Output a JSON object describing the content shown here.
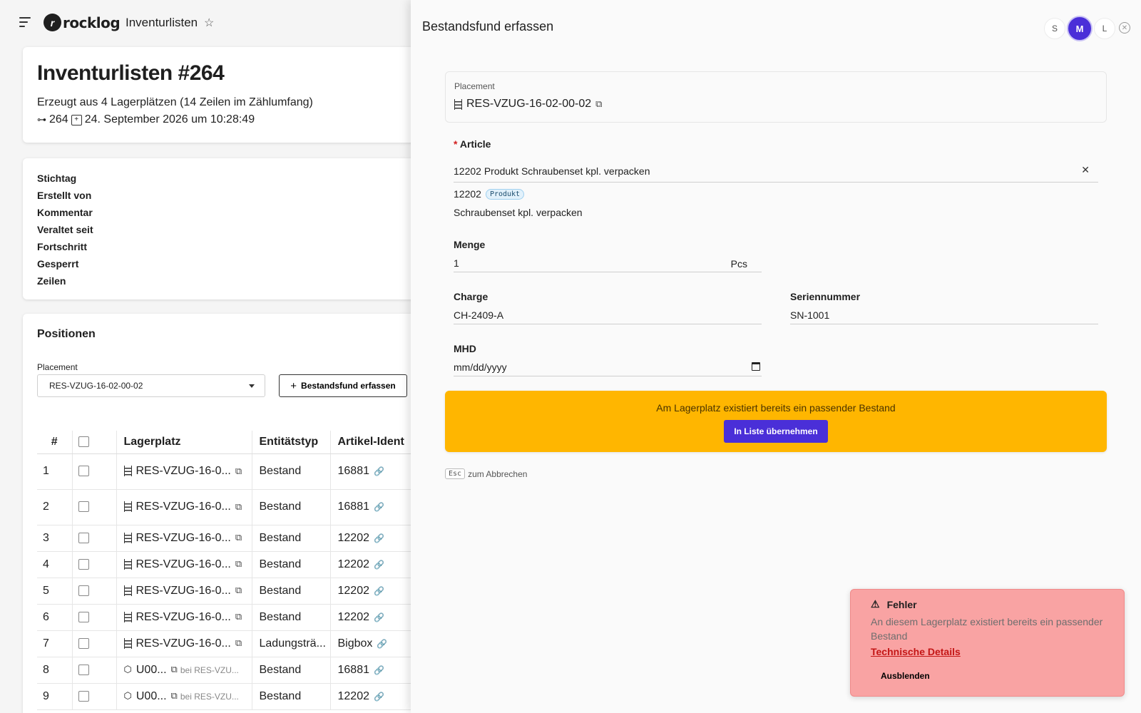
{
  "header": {
    "logo_text": "rocklog",
    "app_title": "Inventurlisten"
  },
  "detail": {
    "title": "Inventurlisten #264",
    "subtitle": "Erzeugt aus 4 Lagerplätzen (14 Zeilen im Zählumfang)",
    "id": "264",
    "created": "24. September 2026 um 10:28:49"
  },
  "properties": [
    "Stichtag",
    "Erstellt von",
    "Kommentar",
    "Veraltet seit",
    "Fortschritt",
    "Gesperrt",
    "Zeilen"
  ],
  "positions": {
    "title": "Positionen",
    "placement_label": "Placement",
    "placement_value": "RES-VZUG-16-02-00-02",
    "add_button": "Bestandsfund erfassen",
    "columns": [
      "#",
      "",
      "Lagerplatz",
      "Entitätstyp",
      "Artikel-Ident"
    ],
    "rows": [
      {
        "num": "1",
        "icon": "shelf",
        "place": "RES-VZUG-16-0...",
        "bei": "",
        "type": "Bestand",
        "article": "16881"
      },
      {
        "num": "2",
        "icon": "shelf",
        "place": "RES-VZUG-16-0...",
        "bei": "",
        "type": "Bestand",
        "article": "16881"
      },
      {
        "num": "3",
        "icon": "shelf",
        "place": "RES-VZUG-16-0...",
        "bei": "",
        "type": "Bestand",
        "article": "12202"
      },
      {
        "num": "4",
        "icon": "shelf",
        "place": "RES-VZUG-16-0...",
        "bei": "",
        "type": "Bestand",
        "article": "12202"
      },
      {
        "num": "5",
        "icon": "shelf",
        "place": "RES-VZUG-16-0...",
        "bei": "",
        "type": "Bestand",
        "article": "12202"
      },
      {
        "num": "6",
        "icon": "shelf",
        "place": "RES-VZUG-16-0...",
        "bei": "",
        "type": "Bestand",
        "article": "12202"
      },
      {
        "num": "7",
        "icon": "shelf",
        "place": "RES-VZUG-16-0...",
        "bei": "",
        "type": "Ladungsträ...",
        "article": "Bigbox"
      },
      {
        "num": "8",
        "icon": "box",
        "place": "U00...",
        "bei": "bei RES-VZU...",
        "type": "Bestand",
        "article": "16881"
      },
      {
        "num": "9",
        "icon": "box",
        "place": "U00...",
        "bei": "bei RES-VZU...",
        "type": "Bestand",
        "article": "12202"
      }
    ]
  },
  "drawer": {
    "title": "Bestandsfund erfassen",
    "sizes": [
      "S",
      "M",
      "L"
    ],
    "active_size": "M",
    "placement_label": "Placement",
    "placement_value": "RES-VZUG-16-02-00-02",
    "article_label": "Article",
    "article_value": "12202 Produkt Schraubenset kpl. verpacken",
    "article_code": "12202",
    "article_badge": "Produkt",
    "article_name": "Schraubenset kpl. verpacken",
    "menge_label": "Menge",
    "menge_value": "1",
    "menge_unit": "Pcs",
    "charge_label": "Charge",
    "charge_value": "CH-2409-A",
    "serial_label": "Seriennummer",
    "serial_value": "SN-1001",
    "mhd_label": "MHD",
    "mhd_placeholder": "mm/dd/yyyy",
    "warning_text": "Am Lagerplatz existiert bereits ein passender Bestand",
    "warning_button": "In Liste übernehmen",
    "hint_key": "Esc",
    "hint_text": "zum Abbrechen"
  },
  "toast": {
    "title": "Fehler",
    "message": "An diesem Lagerplatz existiert bereits ein passender Bestand",
    "link": "Technische Details",
    "button": "Ausblenden"
  },
  "colors": {
    "accent": "#4a2fd8",
    "warning": "#ffb600",
    "error_bg": "#f9a3a3",
    "error_link": "#c41616"
  }
}
